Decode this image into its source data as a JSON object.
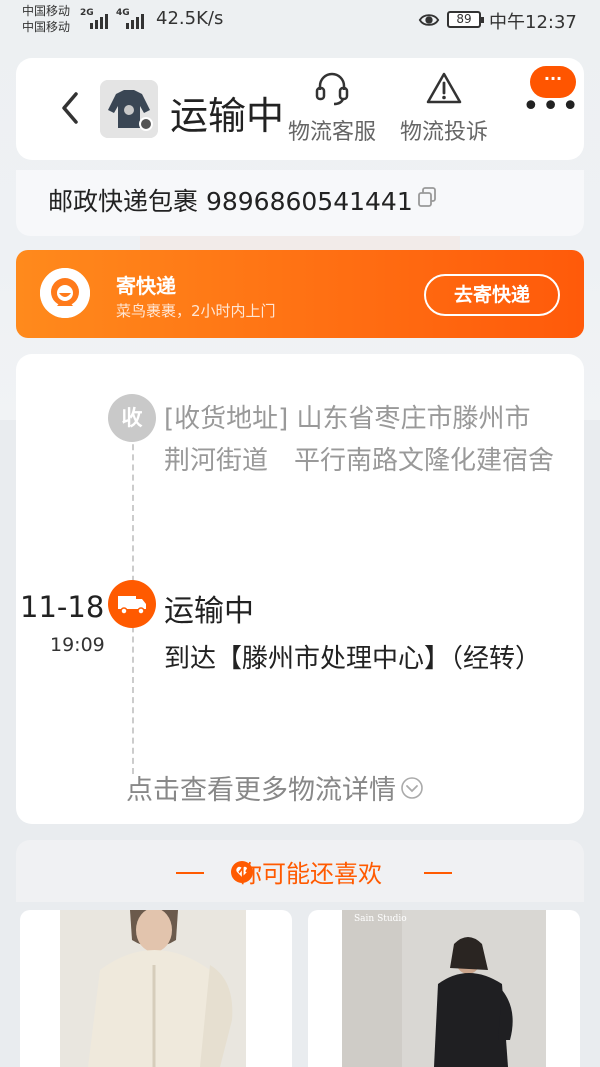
{
  "status_bar": {
    "carrier_1": "中国移动",
    "carrier_2": "中国移动",
    "net_1": "2G",
    "net_2": "4G",
    "net_speed": "42.5K/s",
    "battery": "89",
    "time": "中午12:37"
  },
  "header": {
    "title": "运输中",
    "customer_service_label": "物流客服",
    "complaint_label": "物流投诉",
    "more_badge": "···"
  },
  "tracking": {
    "carrier_and_number": "邮政快递包裹 9896860541441"
  },
  "promo": {
    "title": "寄快递",
    "subtitle": "菜鸟裹裹，2小时内上门",
    "button_label": "去寄快递",
    "accent_color": "#ff6a12"
  },
  "timeline": {
    "receive_node_label": "收",
    "receive_address": "[收货地址] 山东省枣庄市滕州市 荆河街道　平行南路文隆化建宿舍",
    "latest_date": "11-18",
    "latest_time": "19:09",
    "latest_status": "运输中",
    "latest_desc": "到达【滕州市处理中心】（经转）",
    "more_link": "点击查看更多物流详情",
    "accent_color": "#ff5a00"
  },
  "recommend": {
    "title": "你可能还喜欢",
    "product_2_brand": "Sain Studio"
  }
}
